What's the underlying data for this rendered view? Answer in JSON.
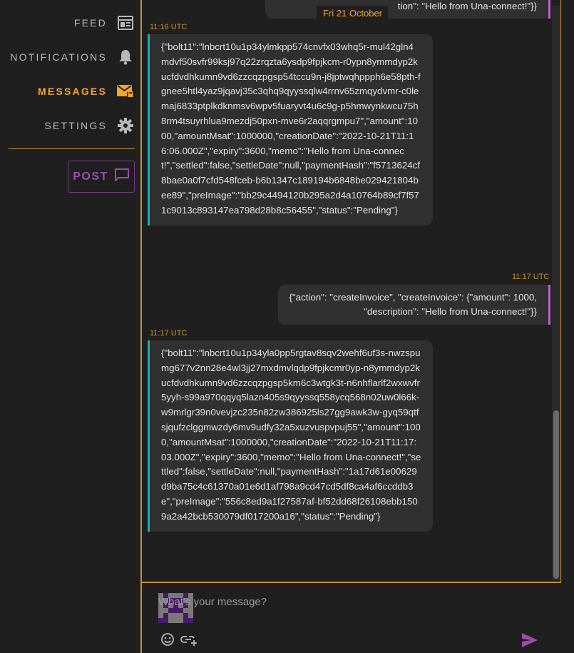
{
  "sidebar": {
    "items": [
      {
        "label": "FEED",
        "icon": "feed-icon"
      },
      {
        "label": "NOTIFICATIONS",
        "icon": "bell-icon"
      },
      {
        "label": "MESSAGES",
        "icon": "mail-lock-icon",
        "active": true
      },
      {
        "label": "SETTINGS",
        "icon": "gear-icon"
      }
    ],
    "post_label": "POST"
  },
  "colors": {
    "accent": "#f5a623",
    "border": "#c8922a",
    "purple": "#9b4db0",
    "incoming": "#1ab0b0",
    "outgoing": "#c060d0"
  },
  "chat": {
    "partial_top_text": "tion\": \"Hello from Una-connect!\"}}",
    "date_separator": "Fri 21 October",
    "messages": [
      {
        "time": "11:16 UTC",
        "direction": "in",
        "text": "{\"bolt11\":\"lnbcrt10u1p34ylmkpp574cnvfx03whq5r-mul42gln4mdvf50svfr99ksj97q22zrqzta6ysdp9fpjkcm-r0ypn8ymmdyp2kucfdvdhkumn9vd6zzcqzpgsp54tccu9n-j8jptwqhppph6e58pth-fgnee5htl4yaz9jqavj35c3qhq9qyyssqlw4rrnv65zmqydvmr-c0lemaj6833ptplkdknmsv6wpv5fuaryvt4u6c9g-p5hmwynkwcu75h8rm4tsuyrhlua9mezdj50pxn-mve6r2aqqrgmpu7\",\"amount\":1000,\"amountMsat\":1000000,\"creationDate\":\"2022-10-21T11:16:06.000Z\",\"expiry\":3600,\"memo\":\"Hello from Una-connect!\",\"settled\":false,\"settleDate\":null,\"paymentHash\":\"f5713624cf8bae0a0f7cfd548fceb-b6b1347c189194b6848be029421804bee89\",\"preImage\":\"bb29c4494120b295a2d4a10764b89cf7f571c9013c893147ea798d28b8c56455\",\"status\":\"Pending\"}"
      },
      {
        "time": "11:17 UTC",
        "direction": "out",
        "text_line1": "{\"action\": \"createInvoice\", \"createInvoice\": {\"amount\": 1000,",
        "text_line2": "\"description\": \"Hello from Una-connect!\"}}"
      },
      {
        "time": "11:17 UTC",
        "direction": "in",
        "text": "{\"bolt11\":\"lnbcrt10u1p34yla0pp5rgtav8sqv2wehf6uf3s-nwzspumg677v2nn28e4wl3jj27mxdmvlqdp9fpjkcmr0yp-n8ymmdyp2kucfdvdhkumn9vd6zzcqzpgsp5km6c3wtgk3t-n6nhflarlf2wxwvfr5yyh-s99a970qqyq5lazn405s9qyyssq558ycq568n02uw0l66k-w9mrlgr39n0vevjzc235n82zw386925ls27gg9awk3w-gyq59qtfsjqufzclggmwzdy6mv9udfy32a5xuzvuspvpuj55\",\"amount\":1000,\"amountMsat\":1000000,\"creationDate\":\"2022-10-21T11:17:03.000Z\",\"expiry\":3600,\"memo\":\"Hello from Una-connect!\",\"settled\":false,\"settleDate\":null,\"paymentHash\":\"1a17d61e00629d9ba75c4c61370a01e6d1af798a9cd47cd5df8ca4af6ccddb3e\",\"preImage\":\"556c8ed9a1f27587af-bf52dd68f26108ebb1509a2a42bcb530079df017200a16\",\"status\":\"Pending\"}"
      }
    ]
  },
  "composer": {
    "placeholder": "What's your message?",
    "emoji_icon": "emoji-icon",
    "link_icon": "link-add-icon",
    "send_icon": "send-icon"
  }
}
